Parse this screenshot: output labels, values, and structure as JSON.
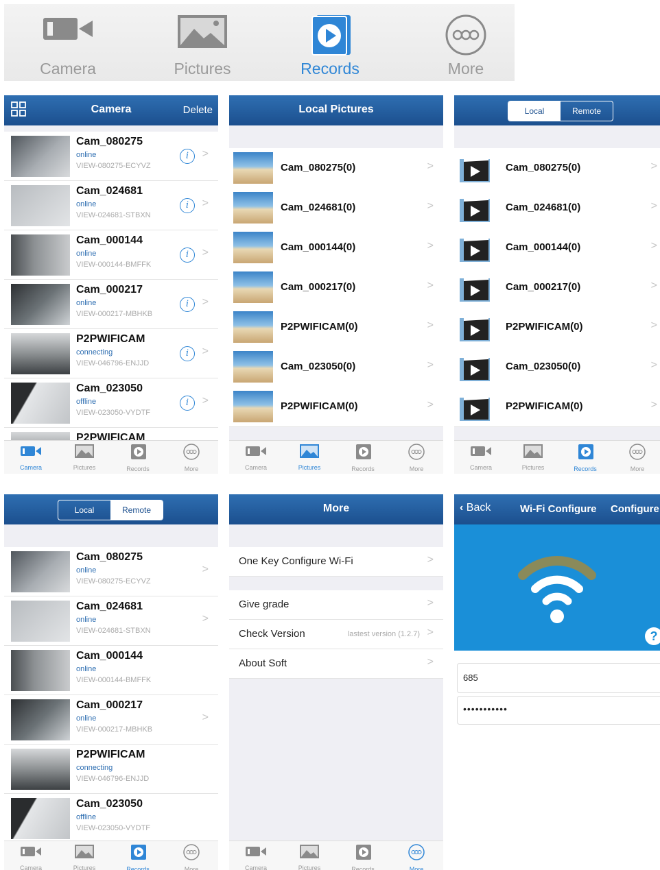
{
  "tabs": [
    {
      "label": "Camera",
      "icon": "camera-icon"
    },
    {
      "label": "Pictures",
      "icon": "pictures-icon"
    },
    {
      "label": "Records",
      "icon": "records-icon"
    },
    {
      "label": "More",
      "icon": "more-icon"
    }
  ],
  "colors": {
    "nav": "#1b4f8e",
    "accent": "#2f86d6",
    "inactive": "#9a9a9a",
    "wifi_bg": "#1a8fd8"
  },
  "camera_screen": {
    "title": "Camera",
    "right": "Delete",
    "cameras": [
      {
        "name": "Cam_080275",
        "status": "online",
        "uid": "VIEW-080275-ECYVZ"
      },
      {
        "name": "Cam_024681",
        "status": "online",
        "uid": "VIEW-024681-STBXN"
      },
      {
        "name": "Cam_000144",
        "status": "online",
        "uid": "VIEW-000144-BMFFK"
      },
      {
        "name": "Cam_000217",
        "status": "online",
        "uid": "VIEW-000217-MBHKB"
      },
      {
        "name": "P2PWIFICAM",
        "status": "connecting",
        "uid": "VIEW-046796-ENJJD"
      },
      {
        "name": "Cam_023050",
        "status": "offline",
        "uid": "VIEW-023050-VYDTF"
      },
      {
        "name": "P2PWIFICAM",
        "status": "",
        "uid": ""
      }
    ]
  },
  "pictures_screen": {
    "title": "Local Pictures",
    "folders": [
      "Cam_080275(0)",
      "Cam_024681(0)",
      "Cam_000144(0)",
      "Cam_000217(0)",
      "P2PWIFICAM(0)",
      "Cam_023050(0)",
      "P2PWIFICAM(0)"
    ]
  },
  "records_screen": {
    "seg_local": "Local",
    "seg_remote": "Remote",
    "folders": [
      "Cam_080275(0)",
      "Cam_024681(0)",
      "Cam_000144(0)",
      "Cam_000217(0)",
      "P2PWIFICAM(0)",
      "Cam_023050(0)",
      "P2PWIFICAM(0)"
    ]
  },
  "remote_screen": {
    "seg_local": "Local",
    "seg_remote": "Remote",
    "cameras": [
      {
        "name": "Cam_080275",
        "status": "online",
        "uid": "VIEW-080275-ECYVZ"
      },
      {
        "name": "Cam_024681",
        "status": "online",
        "uid": "VIEW-024681-STBXN"
      },
      {
        "name": "Cam_000144",
        "status": "online",
        "uid": "VIEW-000144-BMFFK"
      },
      {
        "name": "Cam_000217",
        "status": "online",
        "uid": "VIEW-000217-MBHKB"
      },
      {
        "name": "P2PWIFICAM",
        "status": "connecting",
        "uid": "VIEW-046796-ENJJD"
      },
      {
        "name": "Cam_023050",
        "status": "offline",
        "uid": "VIEW-023050-VYDTF"
      }
    ]
  },
  "more_screen": {
    "title": "More",
    "items": [
      {
        "label": "One Key Configure Wi-Fi",
        "value": ""
      },
      {
        "label": "Give grade",
        "value": ""
      },
      {
        "label": "Check Version",
        "value": "lastest version (1.2.7)"
      },
      {
        "label": "About Soft",
        "value": ""
      }
    ]
  },
  "wifi_screen": {
    "back": "Back",
    "title": "Wi-Fi Configure",
    "right": "Configure",
    "help": "?",
    "ssid_value": "685",
    "password_value": "•••••••••••"
  }
}
